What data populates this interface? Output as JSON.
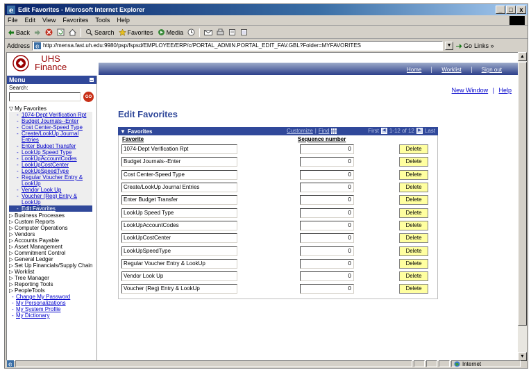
{
  "window": {
    "title": "Edit Favorites - Microsoft Internet Explorer",
    "min_label": "_",
    "max_label": "□",
    "close_label": "x"
  },
  "menubar": [
    "File",
    "Edit",
    "View",
    "Favorites",
    "Tools",
    "Help"
  ],
  "toolbar": {
    "back": "Back",
    "search": "Search",
    "favorites": "Favorites",
    "media": "Media"
  },
  "address": {
    "label": "Address",
    "url": "http://mensa.fast.uh.edu:9980/psp/fspsd/EMPLOYEE/ERP/c/PORTAL_ADMIN.PORTAL_EDIT_FAV.GBL?Folder=MYFAVORITES",
    "go": "Go",
    "links": "Links"
  },
  "header": {
    "logo_line1": "UHS",
    "logo_line2": "Finance",
    "nav": [
      "Home",
      "Worklist",
      "Sign out"
    ]
  },
  "sidebar": {
    "menu_title": "Menu",
    "search_label": "Search:",
    "go_label": "GO",
    "favorites_folder": "My Favorites",
    "favorites": [
      "1074-Dept Verification Rpt",
      "Budget Journals--Enter",
      "Cost Center-Speed Type",
      "Create/LookUp Journal Entries",
      "Enter Budget Transfer",
      "LookUp Speed Type",
      "LookUpAccountCodes",
      "LookUpCostCenter",
      "LookUpSpeedType",
      "Regular Voucher Entry & LookUp",
      "Vendor Look Up",
      "Voucher (Reg) Entry & LookUp",
      "Edit Favorites"
    ],
    "folders": [
      "Business Processes",
      "Custom Reports",
      "Computer Operations",
      "Vendors",
      "Accounts Payable",
      "Asset Management",
      "Commitment Control",
      "General Ledger",
      "Set Up Financials/Supply Chain",
      "Worklist",
      "Tree Manager",
      "Reporting Tools",
      "PeopleTools"
    ],
    "links": [
      "Change My Password",
      "My Personalizations",
      "My System Profile",
      "My Dictionary"
    ]
  },
  "main": {
    "new_window": "New Window",
    "separator": "|",
    "help": "Help",
    "title": "Edit Favorites",
    "grid": {
      "title": "Favorites",
      "customize": "Customize",
      "find": "Find",
      "first": "First",
      "range": "1-12 of 12",
      "last": "Last",
      "col_favorite": "Favorite",
      "col_sequence": "Sequence number",
      "delete_label": "Delete",
      "rows": [
        {
          "favorite": "1074-Dept Verification Rpt",
          "seq": "0"
        },
        {
          "favorite": "Budget Journals--Enter",
          "seq": "0"
        },
        {
          "favorite": "Cost Center-Speed Type",
          "seq": "0"
        },
        {
          "favorite": "Create/LookUp Journal Entries",
          "seq": "0"
        },
        {
          "favorite": "Enter Budget Transfer",
          "seq": "0"
        },
        {
          "favorite": "LookUp Speed Type",
          "seq": "0"
        },
        {
          "favorite": "LookUpAccountCodes",
          "seq": "0"
        },
        {
          "favorite": "LookUpCostCenter",
          "seq": "0"
        },
        {
          "favorite": "LookUpSpeedType",
          "seq": "0"
        },
        {
          "favorite": "Regular Voucher Entry & LookUp",
          "seq": "0"
        },
        {
          "favorite": "Vendor Look Up",
          "seq": "0"
        },
        {
          "favorite": "Voucher (Reg) Entry & LookUp",
          "seq": "0"
        }
      ]
    }
  },
  "status": {
    "zone": "Internet"
  },
  "colors": {
    "ps_blue": "#30489a",
    "link_blue": "#0000cc",
    "button_yellow": "#ffffa0",
    "logo_red": "#990000"
  }
}
